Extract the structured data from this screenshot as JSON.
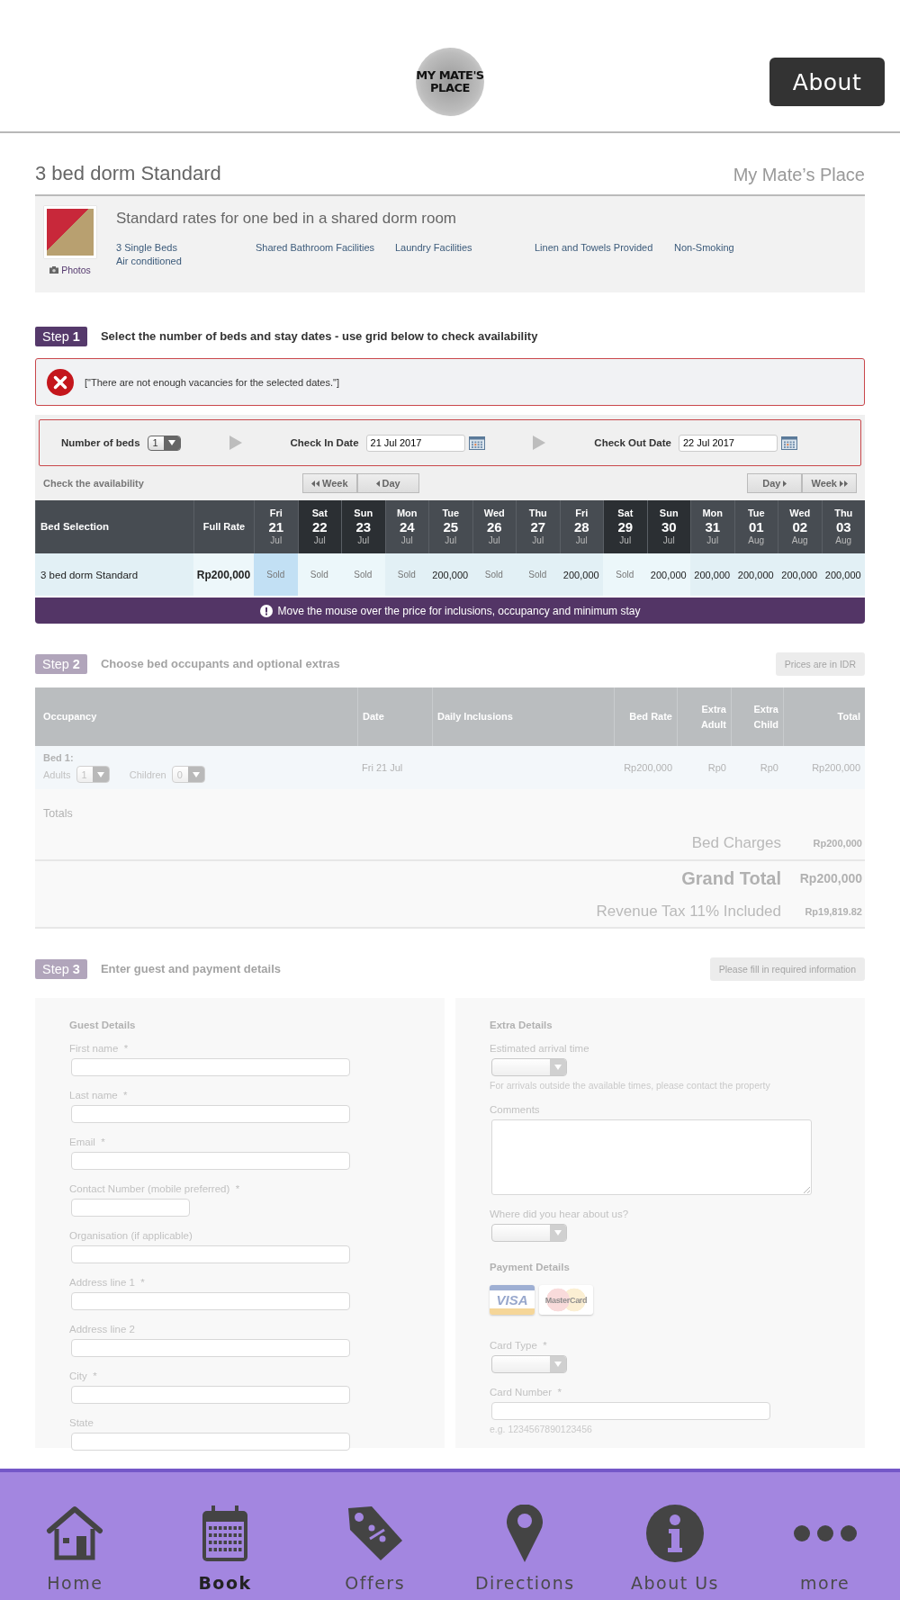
{
  "header": {
    "logo_lines": [
      "MY MATE'S",
      "PLACE"
    ],
    "about_button": "About"
  },
  "room": {
    "title": "3 bed dorm Standard",
    "property": "My Mate’s Place",
    "description": "Standard rates for one bed in a shared dorm room",
    "photos_link": "Photos",
    "features": [
      "3 Single Beds",
      "Shared Bathroom Facilities",
      "Laundry Facilities",
      "Linen and Towels Provided",
      "Non-Smoking",
      "Air conditioned"
    ]
  },
  "step1": {
    "badge": "Step **1**",
    "title": "Select the number of beds and stay dates - use grid below to check availability",
    "disabled": false
  },
  "error": {
    "message": "[\"There are not enough vacancies for the selected dates.\"]"
  },
  "booking_form": {
    "beds_label": "Number of beds",
    "beds_value": "1",
    "check_in_label": "Check In Date",
    "check_in": "21 Jul 2017",
    "check_out_label": "Check Out Date",
    "check_out": "22 Jul 2017"
  },
  "availability": {
    "label": "Check the availability",
    "prev_buttons": [
      "Week",
      "Day"
    ],
    "next_buttons": [
      "Day",
      "Week"
    ]
  },
  "grid": {
    "columns": [
      "Bed Selection",
      "Full Rate"
    ],
    "row": {
      "name": "3 bed dorm Standard",
      "rate": "Rp200,000"
    },
    "days": [
      {
        "dow": "Fri",
        "day": "21",
        "month": "Jul",
        "weekend": false,
        "selected": true,
        "sold": true,
        "value": "Sold"
      },
      {
        "dow": "Sat",
        "day": "22",
        "month": "Jul",
        "weekend": true,
        "selected": false,
        "sold": true,
        "value": "Sold"
      },
      {
        "dow": "Sun",
        "day": "23",
        "month": "Jul",
        "weekend": true,
        "selected": false,
        "sold": true,
        "value": "Sold"
      },
      {
        "dow": "Mon",
        "day": "24",
        "month": "Jul",
        "weekend": false,
        "selected": false,
        "sold": true,
        "value": "Sold"
      },
      {
        "dow": "Tue",
        "day": "25",
        "month": "Jul",
        "weekend": false,
        "selected": false,
        "sold": false,
        "value": "200,000"
      },
      {
        "dow": "Wed",
        "day": "26",
        "month": "Jul",
        "weekend": false,
        "selected": false,
        "sold": true,
        "value": "Sold"
      },
      {
        "dow": "Thu",
        "day": "27",
        "month": "Jul",
        "weekend": false,
        "selected": false,
        "sold": true,
        "value": "Sold"
      },
      {
        "dow": "Fri",
        "day": "28",
        "month": "Jul",
        "weekend": false,
        "selected": false,
        "sold": false,
        "value": "200,000"
      },
      {
        "dow": "Sat",
        "day": "29",
        "month": "Jul",
        "weekend": true,
        "selected": false,
        "sold": true,
        "value": "Sold"
      },
      {
        "dow": "Sun",
        "day": "30",
        "month": "Jul",
        "weekend": true,
        "selected": false,
        "sold": false,
        "value": "200,000"
      },
      {
        "dow": "Mon",
        "day": "31",
        "month": "Jul",
        "weekend": false,
        "selected": false,
        "sold": false,
        "value": "200,000"
      },
      {
        "dow": "Tue",
        "day": "01",
        "month": "Aug",
        "weekend": false,
        "selected": false,
        "sold": false,
        "value": "200,000"
      },
      {
        "dow": "Wed",
        "day": "02",
        "month": "Aug",
        "weekend": false,
        "selected": false,
        "sold": false,
        "value": "200,000"
      },
      {
        "dow": "Thu",
        "day": "03",
        "month": "Aug",
        "weekend": false,
        "selected": false,
        "sold": false,
        "value": "200,000"
      }
    ],
    "hint": "Move the mouse over the price for inclusions, occupancy and minimum stay"
  },
  "step2": {
    "badge": "Step **2**",
    "title": "Choose bed occupants and optional extras",
    "disabled": true,
    "status_button": "Prices are in IDR",
    "columns": [
      "Occupancy",
      "Date",
      "Daily Inclusions",
      "Bed Rate",
      "Extra Adult",
      "Extra Child",
      "Total"
    ],
    "row": {
      "bed_label": "Bed 1:",
      "adults_label": "Adults",
      "adults_value": "1",
      "children_label": "Children",
      "children_value": "0",
      "date": "Fri 21 Jul",
      "bed_rate": "Rp200,000",
      "extra_adult": "Rp0",
      "extra_child": "Rp0",
      "total": "Rp200,000"
    },
    "totals_label": "Totals",
    "totals": [
      {
        "kind": "sub",
        "label": "Bed Charges",
        "value": "Rp200,000"
      },
      {
        "kind": "grand",
        "label": "Grand Total",
        "value": "Rp200,000"
      },
      {
        "kind": "tax",
        "label": "Revenue Tax 11% Included",
        "value": "Rp19,819.82"
      }
    ]
  },
  "step3": {
    "badge": "Step **3**",
    "title": "Enter guest and payment details",
    "disabled": true,
    "status_button": "Please fill in required information",
    "guest": {
      "title": "Guest Details",
      "fields": [
        {
          "kind": "text",
          "label": "First name  *"
        },
        {
          "kind": "text",
          "label": "Last name  *"
        },
        {
          "kind": "text",
          "label": "Email  *"
        },
        {
          "kind": "short",
          "label": "Contact Number (mobile preferred)  *"
        },
        {
          "kind": "text",
          "label": "Organisation (if applicable)"
        },
        {
          "kind": "text",
          "label": "Address line 1  *"
        },
        {
          "kind": "text",
          "label": "Address line 2"
        },
        {
          "kind": "text",
          "label": "City  *"
        },
        {
          "kind": "text",
          "label": "State"
        }
      ]
    },
    "extra": {
      "title": "Extra Details",
      "fields": [
        {
          "kind": "select",
          "label": "Estimated arrival time",
          "hint": "For arrivals outside the available times, please contact the property"
        },
        {
          "kind": "textarea",
          "label": "Comments"
        },
        {
          "kind": "select",
          "label": "Where did you hear about us?"
        }
      ]
    },
    "payment": {
      "title": "Payment Details",
      "cards": [
        "VISA",
        "MasterCard"
      ],
      "fields": [
        {
          "kind": "select",
          "label": "Card Type  *"
        },
        {
          "kind": "text",
          "label": "Card Number  *",
          "hint": "e.g. 1234567890123456"
        }
      ]
    }
  },
  "bottom_nav": [
    {
      "kind": "home",
      "label": "Home",
      "selected": false
    },
    {
      "kind": "calendar",
      "label": "Book",
      "selected": true
    },
    {
      "kind": "tag",
      "label": "Offers",
      "selected": false
    },
    {
      "kind": "pin",
      "label": "Directions",
      "selected": false
    },
    {
      "kind": "info",
      "label": "About Us",
      "selected": false
    },
    {
      "kind": "more",
      "label": "more",
      "selected": false
    }
  ]
}
